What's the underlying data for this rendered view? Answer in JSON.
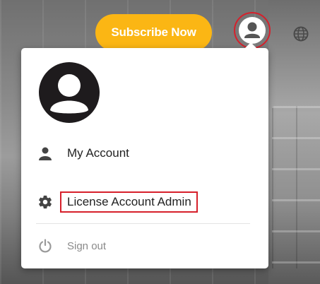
{
  "header": {
    "subscribe_label": "Subscribe Now",
    "icons": [
      "user-icon",
      "globe-icon"
    ]
  },
  "menu": {
    "avatar_icon": "user-icon",
    "items": [
      {
        "label": "My Account",
        "icon": "person-icon"
      },
      {
        "label": "License Account Admin",
        "icon": "gear-icon"
      },
      {
        "label": "Sign out",
        "icon": "power-icon"
      }
    ]
  },
  "colors": {
    "accent": "#fbb614",
    "highlight": "#d6202b",
    "avatar": "#1e1b1d"
  }
}
